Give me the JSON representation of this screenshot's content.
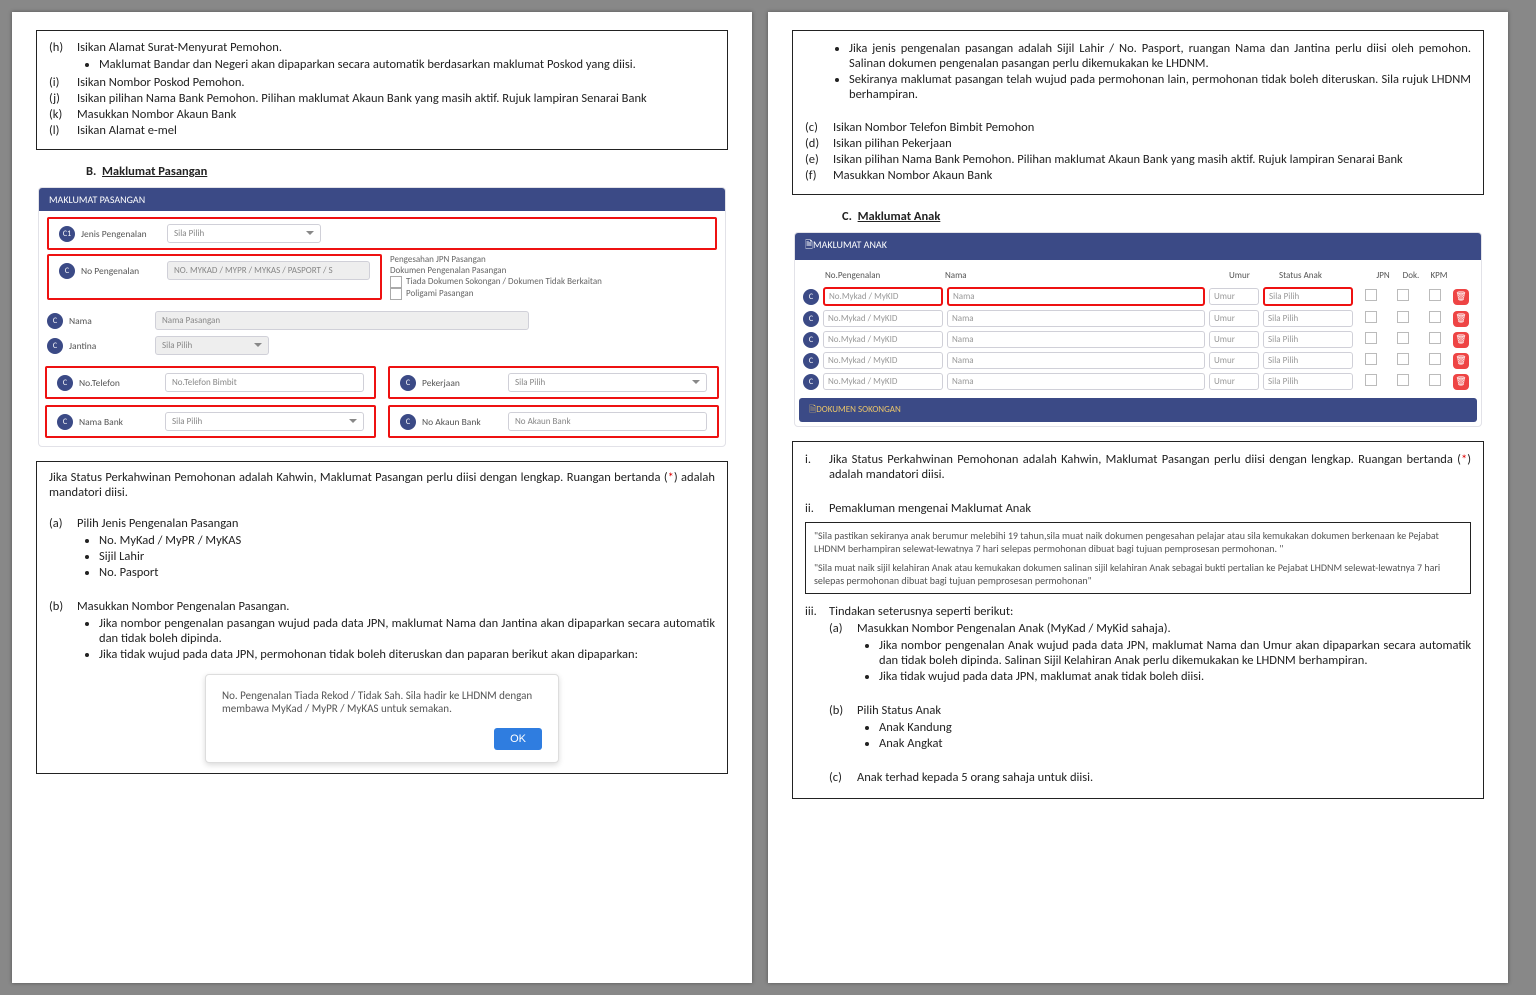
{
  "left": {
    "topItems": {
      "h": "Isikan Alamat Surat-Menyurat Pemohon.",
      "h_bul": "Maklumat Bandar dan Negeri akan dipaparkan secara automatik berdasarkan maklumat Poskod yang diisi.",
      "i": "Isikan Nombor Poskod Pemohon.",
      "j": "Isikan pilihan Nama Bank Pemohon. Pilihan maklumat Akaun Bank yang masih aktif. Rujuk lampiran Senarai Bank",
      "k": "Masukkan Nombor Akaun Bank",
      "l": "Isikan Alamat e-mel"
    },
    "secB_title": "B.  Maklumat Pasangan",
    "form": {
      "bar": "MAKLUMAT PASANGAN",
      "jenis_label": "Jenis Pengenalan",
      "sila_pilih": "Sila Pilih",
      "no_peng_label": "No Pengenalan",
      "no_peng_ph": "NO. MYKAD / MYPR / MYKAS / PASPORT / S",
      "peng_jpn": "Pengesahan JPN Pasangan",
      "dok_peng": "Dokumen Pengenalan Pasangan",
      "tiada_dok": "Tiada Dokumen Sokongan / Dokumen Tidak Berkaitan",
      "poligami": "Poligami Pasangan",
      "nama_label": "Nama",
      "nama_ph": "Nama Pasangan",
      "jantina_label": "Jantina",
      "notel_label": "No.Telefon",
      "notel_ph": "No.Telefon Bimbit",
      "pekerjaan_label": "Pekerjaan",
      "bank_label": "Nama Bank",
      "akaun_label": "No Akaun Bank",
      "akaun_ph": "No Akaun Bank"
    },
    "body": {
      "intro1": "Jika Status Perkahwinan Pemohonan adalah Kahwin, Maklumat Pasangan perlu diisi dengan lengkap. Ruangan bertanda (",
      "intro_star": "*",
      "intro2": ") adalah mandatori diisi.",
      "a": "Pilih Jenis Pengenalan Pasangan",
      "a1": "No. MyKad / MyPR / MyKAS",
      "a2": "Sijil Lahir",
      "a3": "No. Pasport",
      "b": "Masukkan Nombor Pengenalan Pasangan.",
      "b1": "Jika nombor pengenalan pasangan wujud pada data JPN, maklumat Nama dan Jantina akan dipaparkan secara automatik dan tidak boleh dipinda.",
      "b2": "Jika tidak wujud pada data JPN, permohonan tidak boleh diteruskan dan paparan berikut akan dipaparkan:"
    },
    "alert": {
      "msg": "No. Pengenalan Tiada Rekod / Tidak Sah. Sila hadir ke LHDNM dengan membawa MyKad / MyPR / MyKAS untuk semakan.",
      "ok": "OK"
    }
  },
  "right": {
    "top": {
      "bul1": "Jika jenis pengenalan pasangan adalah Sijil Lahir / No. Pasport, ruangan Nama dan Jantina perlu diisi oleh pemohon. Salinan dokumen pengenalan pasangan perlu dikemukakan ke LHDNM.",
      "bul2": "Sekiranya maklumat pasangan telah wujud pada permohonan lain, permohonan tidak boleh diteruskan. Sila rujuk LHDNM berhampiran.",
      "c": "Isikan Nombor Telefon Bimbit Pemohon",
      "d": "Isikan pilihan Pekerjaan",
      "e": "Isikan pilihan Nama Bank Pemohon. Pilihan maklumat Akaun Bank yang masih aktif. Rujuk lampiran Senarai Bank",
      "f": "Masukkan Nombor Akaun Bank"
    },
    "secC_title": "C.  Maklumat Anak",
    "tbl": {
      "bar": "🗎MAKLUMAT ANAK",
      "h_no": "No.Pengenalan",
      "h_nama": "Nama",
      "h_umur": "Umur",
      "h_status": "Status Anak",
      "h_jpn": "JPN",
      "h_dok": "Dok.",
      "h_kpm": "KPM",
      "cell_no": "No.Mykad / MyKID",
      "cell_nama": "Nama",
      "cell_umur": "Umur",
      "cell_status": "Sila Pilih",
      "bar2": "🗎DOKUMEN SOKONGAN"
    },
    "body": {
      "i1": "Jika Status Perkahwinan Pemohonan adalah Kahwin, Maklumat Pasangan perlu diisi dengan lengkap. Ruangan bertanda (",
      "i_star": "*",
      "i2": ") adalah mandatori diisi.",
      "ii": "Pemakluman mengenai Maklumat Anak",
      "note1": "\"Sila pastikan sekiranya anak berumur melebihi 19 tahun,sila muat naik dokumen pengesahan pelajar atau sila kemukakan dokumen berkenaan ke Pejabat LHDNM berhampiran selewat-lewatnya 7 hari selepas permohonan dibuat bagi tujuan pemprosesan permohonan. \"",
      "note2": "\"Sila muat naik sijil kelahiran Anak atau kemukakan dokumen salinan sijil kelahiran Anak sebagai bukti pertalian ke Pejabat LHDNM selewat-lewatnya 7 hari selepas permohonan dibuat bagi tujuan pemprosesan permohonan\"",
      "iii": "Tindakan seterusnya seperti berikut:",
      "a": "Masukkan Nombor Pengenalan Anak (MyKad / MyKid sahaja).",
      "a1": "Jika nombor pengenalan Anak wujud pada data JPN, maklumat Nama dan Umur akan dipaparkan secara automatik dan tidak boleh dipinda. Salinan Sijil Kelahiran Anak perlu dikemukakan ke LHDNM berhampiran.",
      "a2": "Jika tidak wujud pada data JPN, maklumat anak tidak boleh diisi.",
      "b": "Pilih Status Anak",
      "b1": "Anak Kandung",
      "b2": "Anak Angkat",
      "c": "Anak terhad kepada 5 orang sahaja untuk diisi."
    }
  }
}
